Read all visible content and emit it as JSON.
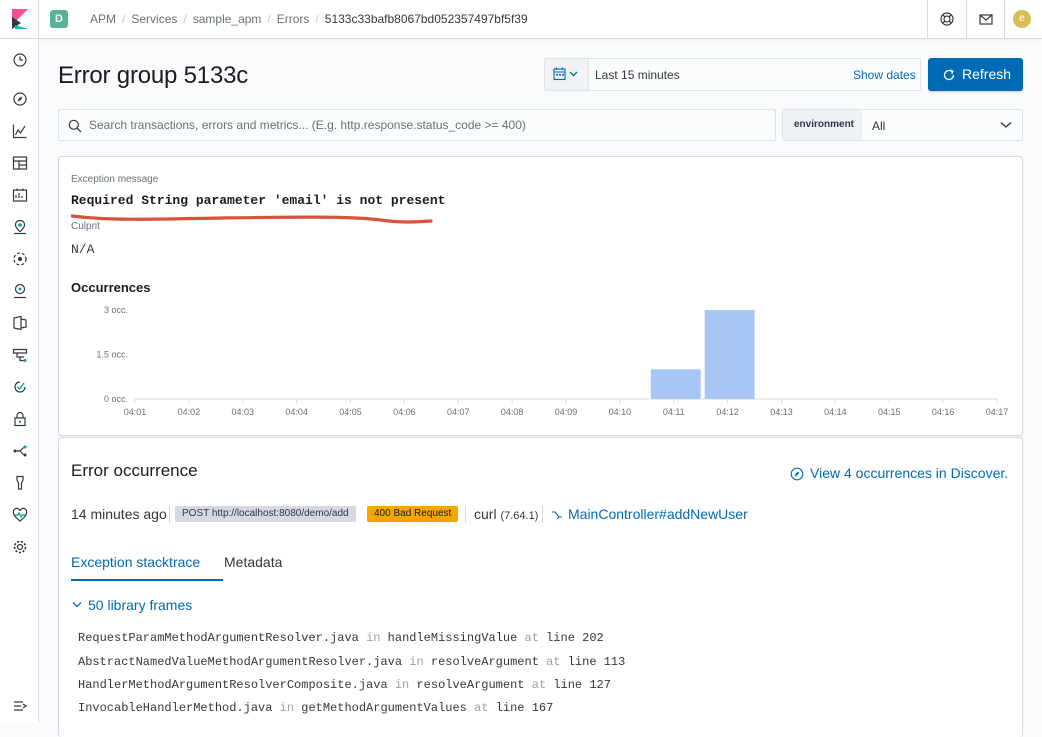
{
  "header": {
    "space_initial": "D",
    "breadcrumbs": [
      "APM",
      "Services",
      "sample_apm",
      "Errors",
      "5133c33bafb8067bd052357497bf5f39"
    ],
    "avatar_initial": "e"
  },
  "page": {
    "title": "Error group 5133c"
  },
  "datepicker": {
    "range": "Last 15 minutes",
    "show_dates": "Show dates",
    "refresh": "Refresh"
  },
  "search": {
    "placeholder": "Search transactions, errors and metrics... (E.g. http.response.status_code >= 400)"
  },
  "environment": {
    "label": "environment",
    "value": "All"
  },
  "summary": {
    "exception_label": "Exception message",
    "exception_message": "Required String parameter 'email' is not present",
    "culprit_label": "Culprit",
    "culprit_value": "N/A",
    "occurrences_title": "Occurrences"
  },
  "chart_data": {
    "type": "bar",
    "title": "Occurrences",
    "categories": [
      "04:01",
      "04:02",
      "04:03",
      "04:04",
      "04:05",
      "04:06",
      "04:07",
      "04:08",
      "04:09",
      "04:10",
      "04:11",
      "04:12",
      "04:13",
      "04:14",
      "04:15",
      "04:16",
      "04:17"
    ],
    "values": [
      0,
      0,
      0,
      0,
      0,
      0,
      0,
      0,
      0,
      0,
      1,
      3,
      0,
      0,
      0,
      0,
      0
    ],
    "y_ticks": [
      "3 occ.",
      "1.5 occ.",
      "0 occ."
    ],
    "ylim": [
      0,
      3
    ],
    "bar_color": "#a7c5f5",
    "grid": false
  },
  "occurrence": {
    "title": "Error occurrence",
    "discover_link": "View 4 occurrences in Discover.",
    "time_ago": "14 minutes ago",
    "request": "POST http://localhost:8080/demo/add",
    "status": "400 Bad Request",
    "agent_name": "curl",
    "agent_version": "(7.64.1)",
    "transaction": "MainController#addNewUser",
    "tabs": [
      "Exception stacktrace",
      "Metadata"
    ],
    "frames_toggle": "50 library frames",
    "frames": [
      {
        "file": "RequestParamMethodArgumentResolver.java",
        "in": "in",
        "method": "handleMissingValue",
        "at": "at",
        "line": "line 202"
      },
      {
        "file": "AbstractNamedValueMethodArgumentResolver.java",
        "in": "in",
        "method": "resolveArgument",
        "at": "at",
        "line": "line 113"
      },
      {
        "file": "HandlerMethodArgumentResolverComposite.java",
        "in": "in",
        "method": "resolveArgument",
        "at": "at",
        "line": "line 127"
      },
      {
        "file": "InvocableHandlerMethod.java",
        "in": "in",
        "method": "getMethodArgumentValues",
        "at": "at",
        "line": "line 167"
      }
    ]
  },
  "colors": {
    "accent": "#006bb4",
    "status_warning": "#f5a700",
    "annotation": "#d9533c"
  }
}
